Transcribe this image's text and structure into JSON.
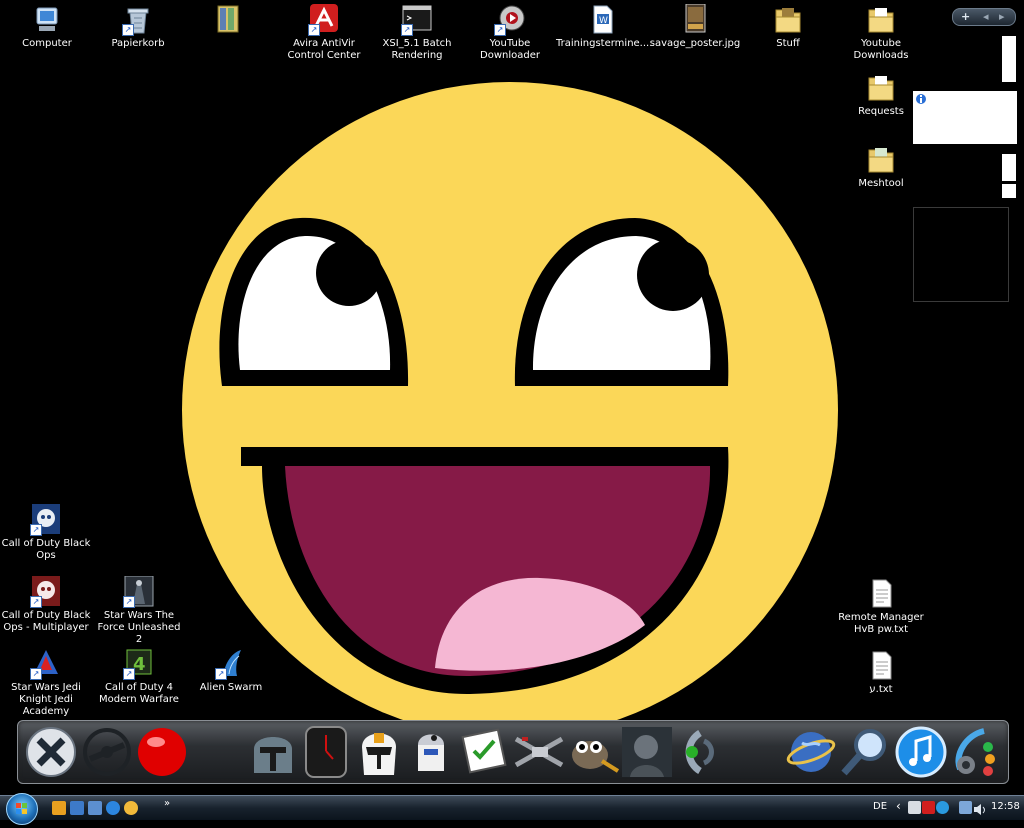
{
  "desktop_icons": [
    {
      "label": "Computer",
      "icon": "computer-icon"
    },
    {
      "label": "Papierkorb",
      "icon": "recycle-bin-icon"
    },
    {
      "label": "",
      "icon": "winrar-archive-icon"
    },
    {
      "label": "Avira AntiVir Control Center",
      "icon": "avira-icon"
    },
    {
      "label": "XSI_5.1 Batch Rendering",
      "icon": "console-icon"
    },
    {
      "label": "YouTube Downloader",
      "icon": "youtube-downloader-icon"
    },
    {
      "label": "Trainingstermine....",
      "icon": "document-icon"
    },
    {
      "label": "savage_poster.jpg",
      "icon": "image-file-icon"
    },
    {
      "label": "Stuff",
      "icon": "folder-icon"
    },
    {
      "label": "Youtube Downloads",
      "icon": "folder-icon"
    },
    {
      "label": "Requests",
      "icon": "folder-icon"
    },
    {
      "label": "Meshtool",
      "icon": "folder-icon"
    },
    {
      "label": "Call of Duty Black Ops",
      "icon": "blackops-icon"
    },
    {
      "label": "Call of Duty Black Ops - Multiplayer",
      "icon": "blackops-mp-icon"
    },
    {
      "label": "Star Wars The Force Unleashed 2",
      "icon": "force-unleashed-icon"
    },
    {
      "label": "Star Wars Jedi Knight Jedi Academy",
      "icon": "jedi-academy-icon"
    },
    {
      "label": "Call of Duty 4 Modern Warfare",
      "icon": "cod4-icon"
    },
    {
      "label": "Alien Swarm",
      "icon": "alien-swarm-icon"
    },
    {
      "label": "Remote Manager HvB pw.txt",
      "icon": "text-file-icon"
    },
    {
      "label": "ע.txt",
      "icon": "text-file-icon"
    }
  ],
  "dock_items": [
    "xfire-icon",
    "steam-icon",
    "red-ball-icon",
    "boba-fett-helmet-icon",
    "clock-gadget-icon",
    "clone-trooper-icon",
    "r2d2-icon",
    "checklist-icon",
    "x-wing-icon",
    "gimp-icon",
    "soldier-game-icon",
    "teamspeak-icon",
    "network-globe-icon",
    "search-magnifier-icon",
    "itunes-icon",
    "settings-gears-icon"
  ],
  "gadget_controls": {
    "add": "+",
    "prev": "◂",
    "next": "▸"
  },
  "taskbar": {
    "overflow": "»",
    "language": "DE",
    "tray_left_arrow": "‹",
    "clock": "12:58"
  },
  "colors": {
    "smiley_yellow": "#FBD758",
    "mouth_purple": "#861A47",
    "tongue_pink": "#F5B7D3"
  }
}
